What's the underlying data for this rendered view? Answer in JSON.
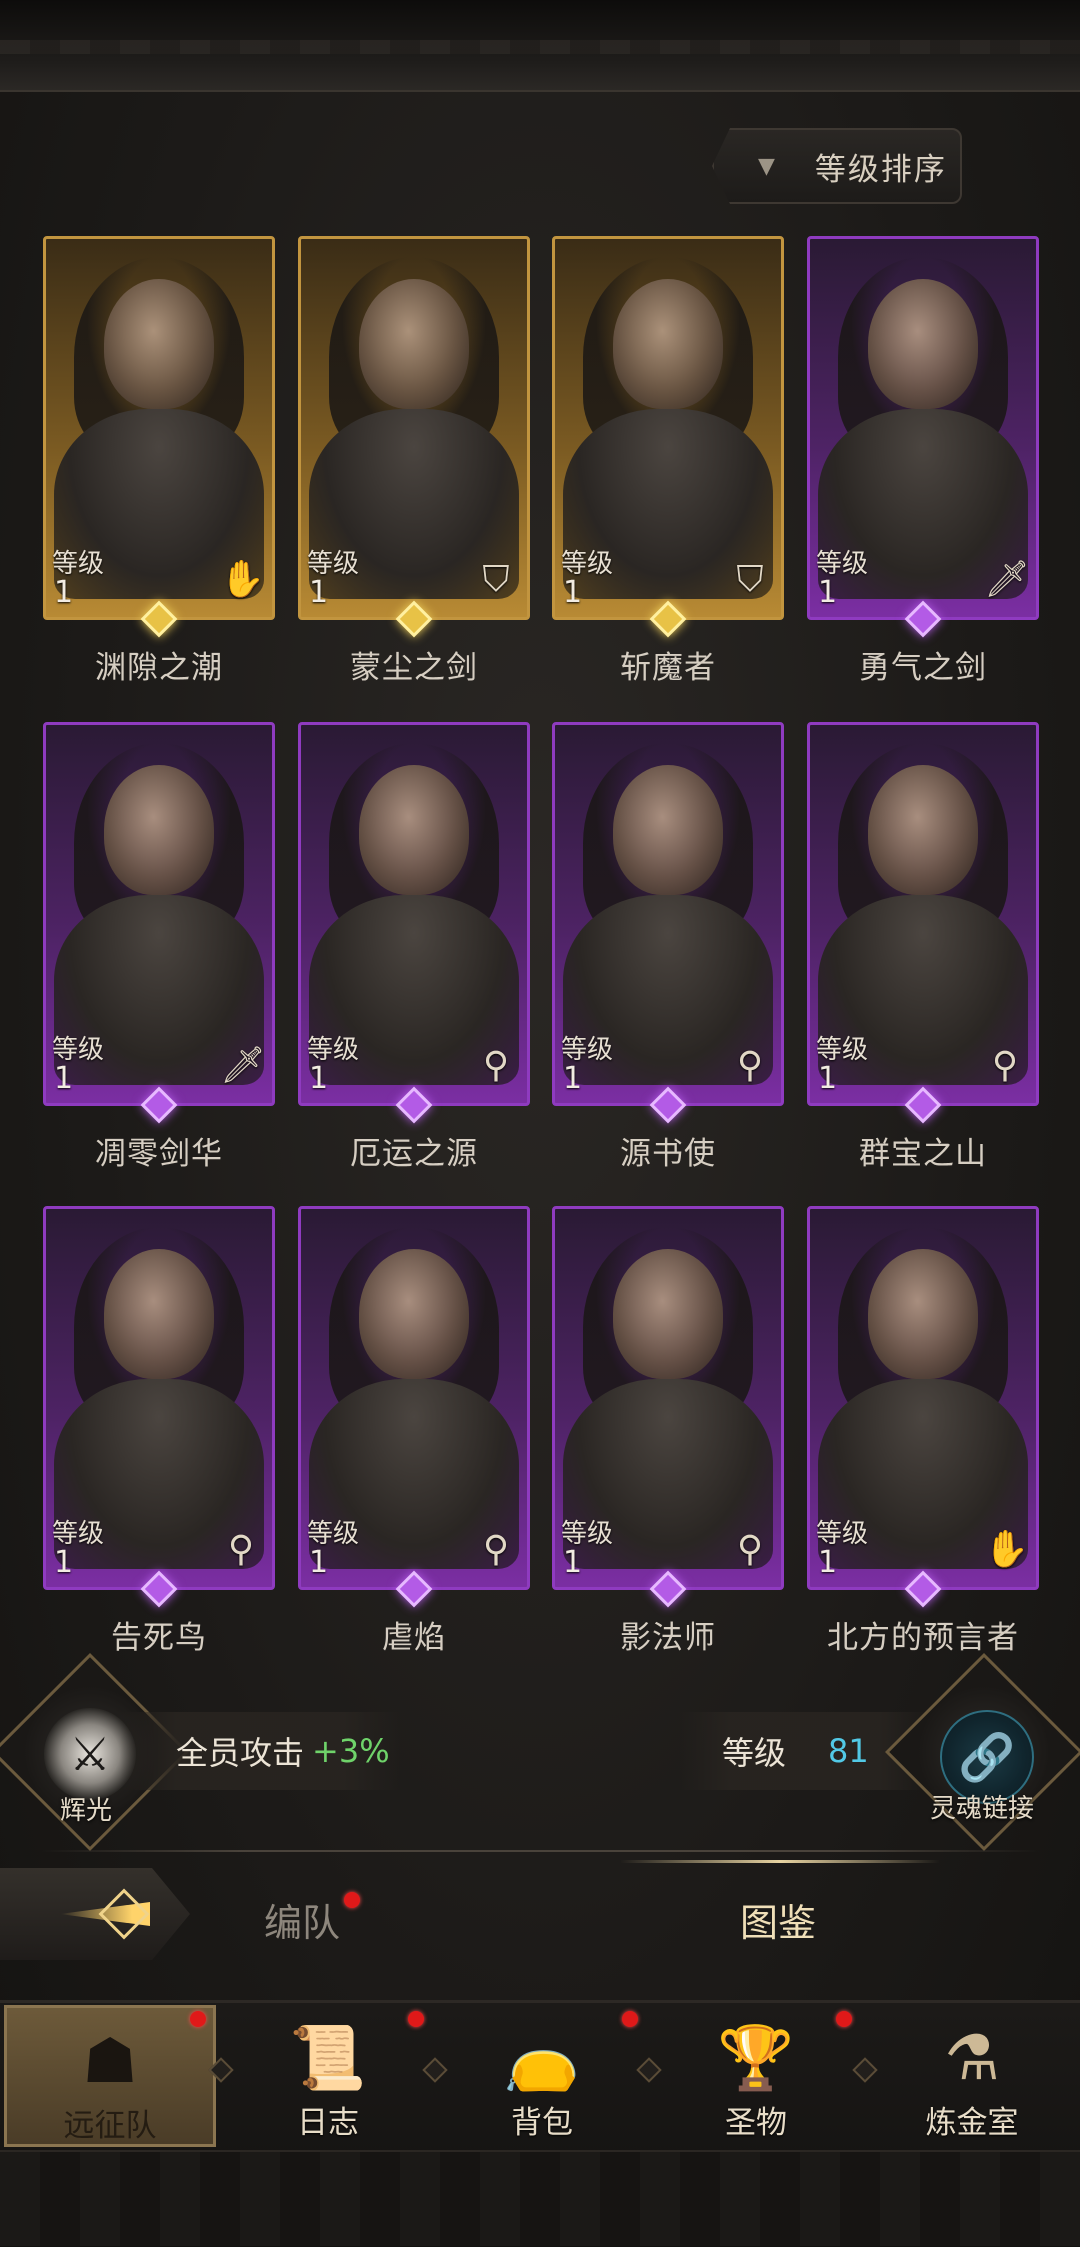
{
  "sort": {
    "arrow": "▼",
    "label": "等级排序"
  },
  "level_label": "等级",
  "heroes": [
    {
      "name": "渊隙之潮",
      "level": "1",
      "rarity": "gold",
      "class_icon": "hand-icon",
      "glyph": "✋"
    },
    {
      "name": "蒙尘之剑",
      "level": "1",
      "rarity": "gold",
      "class_icon": "shield-icon",
      "glyph": "⛉"
    },
    {
      "name": "斩魔者",
      "level": "1",
      "rarity": "gold",
      "class_icon": "shield-icon",
      "glyph": "⛉"
    },
    {
      "name": "勇气之剑",
      "level": "1",
      "rarity": "purple",
      "class_icon": "sword-icon",
      "glyph": "🗡"
    },
    {
      "name": "凋零剑华",
      "level": "1",
      "rarity": "purple",
      "class_icon": "sword-icon",
      "glyph": "🗡"
    },
    {
      "name": "厄运之源",
      "level": "1",
      "rarity": "purple",
      "class_icon": "staff-icon",
      "glyph": "⚲"
    },
    {
      "name": "源书使",
      "level": "1",
      "rarity": "purple",
      "class_icon": "staff-icon",
      "glyph": "⚲"
    },
    {
      "name": "群宝之山",
      "level": "1",
      "rarity": "purple",
      "class_icon": "staff-icon",
      "glyph": "⚲"
    },
    {
      "name": "告死鸟",
      "level": "1",
      "rarity": "purple",
      "class_icon": "staff-icon",
      "glyph": "⚲"
    },
    {
      "name": "虐焰",
      "level": "1",
      "rarity": "purple",
      "class_icon": "staff-icon",
      "glyph": "⚲"
    },
    {
      "name": "影法师",
      "level": "1",
      "rarity": "purple",
      "class_icon": "staff-icon",
      "glyph": "⚲"
    },
    {
      "name": "北方的预言者",
      "level": "1",
      "rarity": "purple",
      "class_icon": "hand-icon",
      "glyph": "✋"
    }
  ],
  "radiance": {
    "label": "辉光",
    "bonus_text": "全员攻击",
    "bonus_value": "+3%"
  },
  "soul_link": {
    "label": "灵魂链接",
    "level_label": "等级",
    "level_value": "81"
  },
  "tabs": [
    {
      "label": "编队",
      "active": false,
      "badge": true
    },
    {
      "label": "图鉴",
      "active": true,
      "badge": false
    }
  ],
  "nav": [
    {
      "label": "远征队",
      "icon": "helmet-icon",
      "glyph": "☗",
      "active": true,
      "badge": true
    },
    {
      "label": "日志",
      "icon": "scroll-icon",
      "glyph": "📜",
      "active": false,
      "badge": true
    },
    {
      "label": "背包",
      "icon": "bag-icon",
      "glyph": "👝",
      "active": false,
      "badge": true
    },
    {
      "label": "圣物",
      "icon": "chalice-icon",
      "glyph": "🏆",
      "active": false,
      "badge": true
    },
    {
      "label": "炼金室",
      "icon": "alchemy-icon",
      "glyph": "⚗",
      "active": false,
      "badge": false
    }
  ],
  "colors": {
    "gold_frame": "#c2953f",
    "purple_frame": "#8f3bc0",
    "bonus_green": "#6fd36a",
    "level_cyan": "#52c9e6",
    "badge_red": "#e01919"
  }
}
